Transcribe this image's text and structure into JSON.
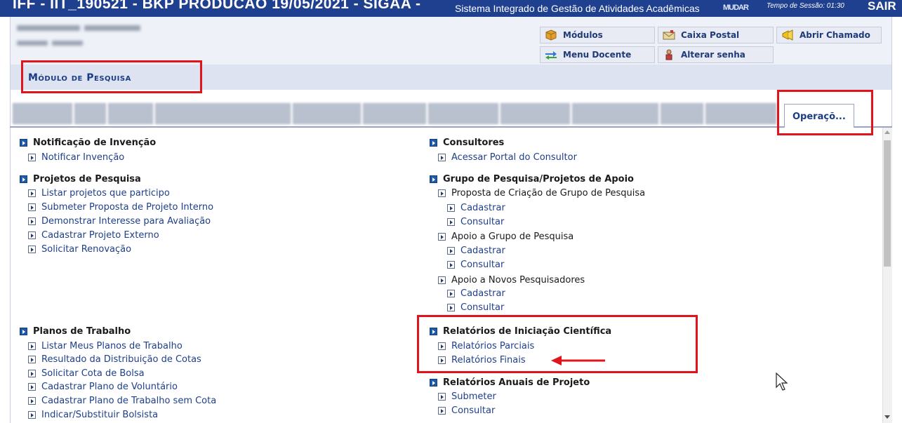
{
  "header": {
    "system_title": "IFF - IIT_190521 - BKP PRODUCAO 19/05/2021 - SIGAA -",
    "system_desc": "Sistema Integrado de Gestão de Atividades Acadêmicas",
    "usuario_label": "MUDAR",
    "sessao_label": "Tempo de Sessão: 01:30",
    "sair_label": "SAIR"
  },
  "shortcuts": {
    "modulos": "Módulos",
    "caixa_postal": "Caixa Postal",
    "abrir_chamado": "Abrir Chamado",
    "menu_docente": "Menu Docente",
    "alterar_senha": "Alterar senha"
  },
  "module_title": "Módulo de Pesquisa",
  "active_tab": "Operaçõ...",
  "left_column": {
    "notificacao": {
      "title": "Notificação de Invenção",
      "links": [
        "Notificar Invenção"
      ]
    },
    "projetos": {
      "title": "Projetos de Pesquisa",
      "links": [
        "Listar projetos que participo",
        "Submeter Proposta de Projeto Interno",
        "Demonstrar Interesse para Avaliação",
        "Cadastrar Projeto Externo",
        "Solicitar Renovação"
      ]
    },
    "planos": {
      "title": "Planos de Trabalho",
      "links": [
        "Listar Meus Planos de Trabalho",
        "Resultado da Distribuição de Cotas",
        "Solicitar Cota de Bolsa",
        "Cadastrar Plano de Voluntário",
        "Cadastrar Plano de Trabalho sem Cota",
        "Indicar/Substituir Bolsista"
      ]
    }
  },
  "right_column": {
    "consultores": {
      "title": "Consultores",
      "links": [
        "Acessar Portal do Consultor"
      ]
    },
    "grupo": {
      "title": "Grupo de Pesquisa/Projetos de Apoio",
      "proposta": "Proposta de Criação de Grupo de Pesquisa",
      "apoio_grupo": "Apoio a Grupo de Pesquisa",
      "apoio_novos": "Apoio a Novos Pesquisadores",
      "cadastrar": "Cadastrar",
      "consultar": "Consultar"
    },
    "relatorios_ic": {
      "title": "Relatórios de Iniciação Científica",
      "links": [
        "Relatórios Parciais",
        "Relatórios Finais"
      ]
    },
    "relatorios_anuais": {
      "title": "Relatórios Anuais de Projeto",
      "links": [
        "Submeter",
        "Consultar"
      ]
    }
  },
  "colors": {
    "top_bar": "#1f3f8f",
    "link": "#1e3f8a",
    "highlight": "#e2141b"
  }
}
